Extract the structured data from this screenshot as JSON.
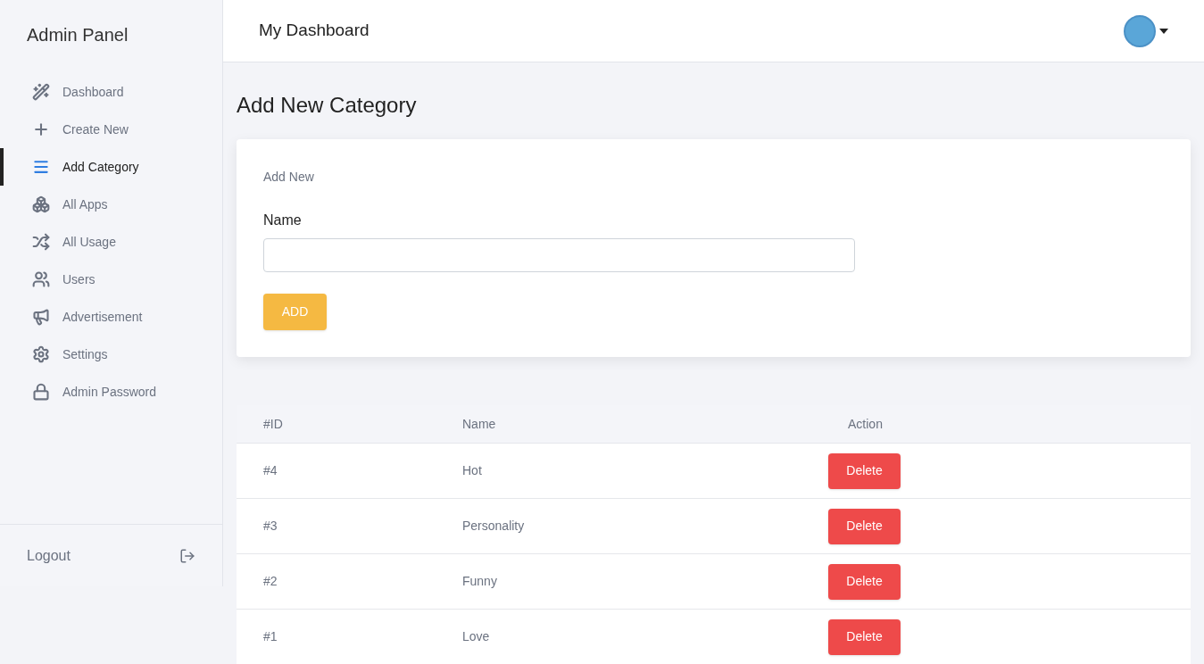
{
  "sidebar": {
    "title": "Admin Panel",
    "items": [
      {
        "label": "Dashboard",
        "selected": false
      },
      {
        "label": "Create New",
        "selected": false
      },
      {
        "label": "Add Category",
        "selected": true
      },
      {
        "label": "All Apps",
        "selected": false
      },
      {
        "label": "All Usage",
        "selected": false
      },
      {
        "label": "Users",
        "selected": false
      },
      {
        "label": "Advertisement",
        "selected": false
      },
      {
        "label": "Settings",
        "selected": false
      },
      {
        "label": "Admin Password",
        "selected": false
      }
    ],
    "logout": "Logout"
  },
  "header": {
    "title": "My Dashboard"
  },
  "page_title": "Add New Category",
  "form": {
    "section": "Add New",
    "label": "Name",
    "button": "ADD"
  },
  "table": {
    "columns": [
      "#ID",
      "Name",
      "Action"
    ],
    "rows": [
      {
        "id": "#4",
        "name": "Hot",
        "action": "Delete"
      },
      {
        "id": "#3",
        "name": "Personality",
        "action": "Delete"
      },
      {
        "id": "#2",
        "name": "Funny",
        "action": "Delete"
      },
      {
        "id": "#1",
        "name": "Love",
        "action": "Delete"
      }
    ]
  }
}
